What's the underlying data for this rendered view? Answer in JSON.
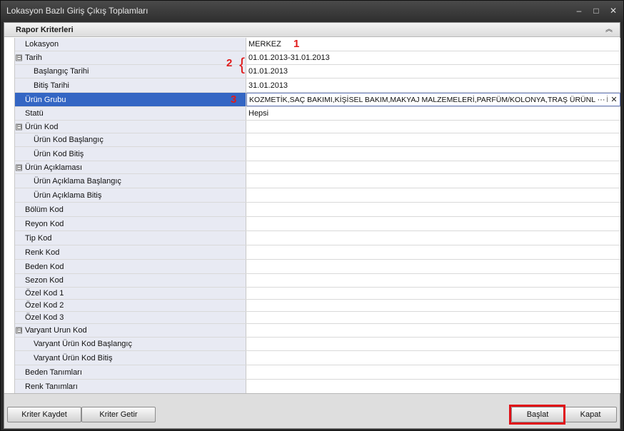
{
  "window": {
    "title": "Lokasyon Bazlı Giriş Çıkış Toplamları",
    "minimize": "–",
    "maximize": "□",
    "close": "✕"
  },
  "panel": {
    "title": "Rapor Kriterleri",
    "collapse_icon": "︽"
  },
  "rows": [
    {
      "label": "Lokasyon",
      "value": "MERKEZ"
    },
    {
      "label": "Tarih",
      "value": "01.01.2013-31.01.2013",
      "expander": "⊟"
    },
    {
      "label": "Başlangıç Tarihi",
      "value": "01.01.2013"
    },
    {
      "label": "Bitiş Tarihi",
      "value": "31.01.2013"
    },
    {
      "label": "Ürün Grubu",
      "value": "KOZMETİK,SAÇ BAKIMI,KİŞİSEL BAKIM,MAKYAJ MALZEMELERİ,PARFÜM/KOLONYA,TRAŞ ÜRÜNLERİ"
    },
    {
      "label": "Statü",
      "value": "Hepsi"
    },
    {
      "label": "Ürün Kod",
      "value": "",
      "expander": "⊟"
    },
    {
      "label": "Ürün Kod Başlangıç",
      "value": ""
    },
    {
      "label": "Ürün Kod Bitiş",
      "value": ""
    },
    {
      "label": "Ürün Açıklaması",
      "value": "",
      "expander": "⊟"
    },
    {
      "label": "Ürün Açıklama Başlangıç",
      "value": ""
    },
    {
      "label": "Ürün Açıklama Bitiş",
      "value": ""
    },
    {
      "label": "Bölüm Kod",
      "value": ""
    },
    {
      "label": "Reyon Kod",
      "value": ""
    },
    {
      "label": "Tip Kod",
      "value": ""
    },
    {
      "label": "Renk Kod",
      "value": ""
    },
    {
      "label": "Beden Kod",
      "value": ""
    },
    {
      "label": "Sezon Kod",
      "value": ""
    },
    {
      "label": "Özel Kod 1",
      "value": ""
    },
    {
      "label": "Özel Kod 2",
      "value": ""
    },
    {
      "label": "Özel Kod 3",
      "value": ""
    },
    {
      "label": "Varyant Urun Kod",
      "value": "",
      "expander": "⊟"
    },
    {
      "label": "Varyant Ürün Kod Başlangıç",
      "value": ""
    },
    {
      "label": "Varyant Ürün Kod Bitiş",
      "value": ""
    },
    {
      "label": "Beden Tanımları",
      "value": ""
    },
    {
      "label": "Renk Tanımları",
      "value": ""
    }
  ],
  "editor": {
    "ellipsis": "···",
    "clear": "✕"
  },
  "annotations": {
    "a1": "1",
    "a2": "2",
    "brace": "{",
    "a3": "3",
    "color": "#e01b1b"
  },
  "buttons": {
    "save_criteria": "Kriter Kaydet",
    "load_criteria": "Kriter Getir",
    "start": "Başlat",
    "close": "Kapat"
  },
  "colors": {
    "selected_row": "#3466c4",
    "label_column": "#e8eaf3",
    "highlight_box": "#e01018"
  }
}
